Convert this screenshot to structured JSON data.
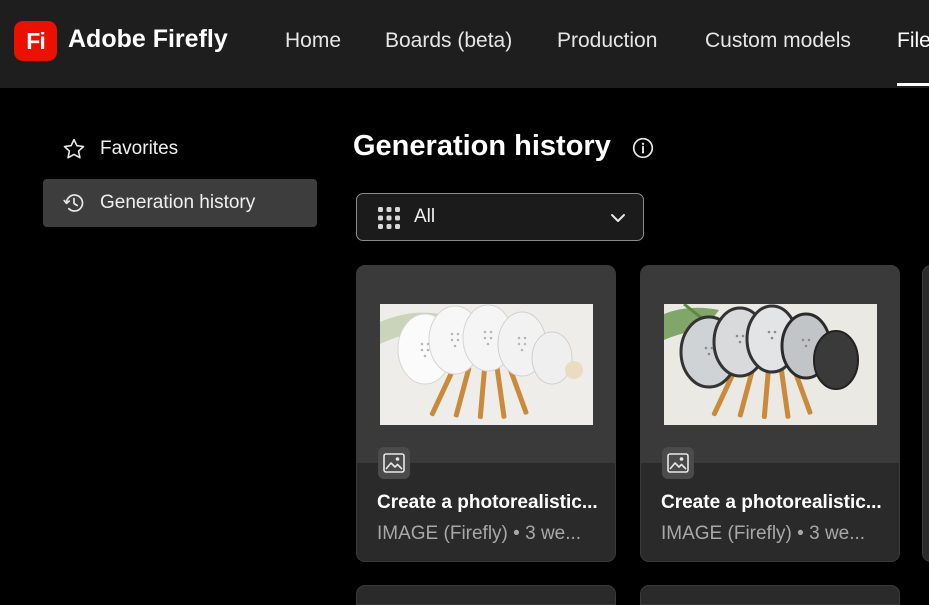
{
  "app": {
    "logo_text": "Fi",
    "name": "Adobe Firefly",
    "brand_color": "#eb1000"
  },
  "nav": {
    "items": [
      {
        "label": "Home"
      },
      {
        "label": "Boards (beta)"
      },
      {
        "label": "Production"
      },
      {
        "label": "Custom models"
      },
      {
        "label": "Files",
        "active": true
      }
    ]
  },
  "sidebar": {
    "items": [
      {
        "label": "Favorites",
        "icon": "star-icon"
      },
      {
        "label": "Generation history",
        "icon": "history-icon",
        "active": true
      }
    ]
  },
  "main": {
    "title": "Generation history",
    "filter": {
      "selected": "All"
    },
    "cards": [
      {
        "title": "Create a photorealistic...",
        "meta": "IMAGE (Firefly) • 3 we...",
        "type_icon": "image-icon"
      },
      {
        "title": "Create a photorealistic...",
        "meta": "IMAGE (Firefly) • 3 we...",
        "type_icon": "image-icon"
      }
    ]
  }
}
